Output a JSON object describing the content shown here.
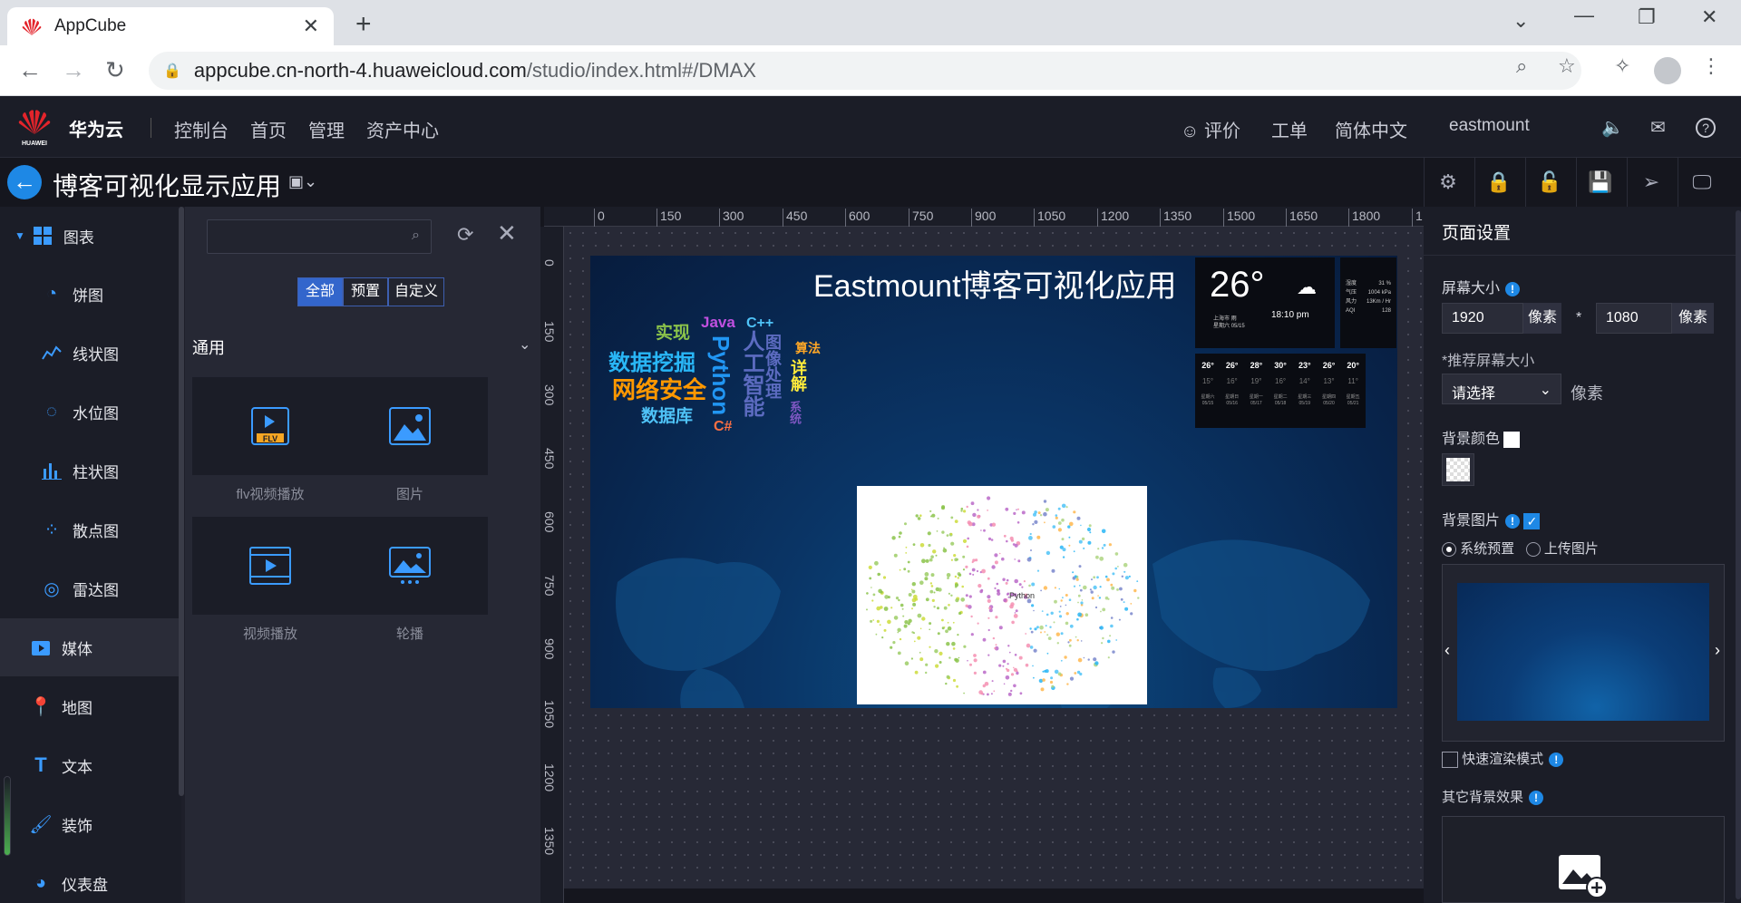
{
  "browser": {
    "tab_title": "AppCube",
    "tab_close": "✕",
    "new_tab": "+",
    "url_host": "appcube.cn-north-4.huaweicloud.com",
    "url_path": "/studio/index.html#/DMAX"
  },
  "header": {
    "brand": "华为云",
    "logo_text": "HUAWEI",
    "nav": [
      "控制台",
      "首页",
      "管理",
      "资产中心"
    ],
    "right": [
      "评价",
      "工单",
      "简体中文",
      "eastmount"
    ]
  },
  "toolbar": {
    "app_title": "博客可视化显示应用"
  },
  "sidebar": {
    "items": [
      {
        "label": "图表",
        "icon": "grid-icon"
      },
      {
        "label": "饼图",
        "icon": "pie-chart-icon"
      },
      {
        "label": "线状图",
        "icon": "line-chart-icon"
      },
      {
        "label": "水位图",
        "icon": "water-level-icon"
      },
      {
        "label": "柱状图",
        "icon": "bar-chart-icon"
      },
      {
        "label": "散点图",
        "icon": "scatter-chart-icon"
      },
      {
        "label": "雷达图",
        "icon": "radar-chart-icon"
      },
      {
        "label": "媒体",
        "icon": "media-icon"
      },
      {
        "label": "地图",
        "icon": "map-pin-icon"
      },
      {
        "label": "文本",
        "icon": "text-icon"
      },
      {
        "label": "装饰",
        "icon": "decoration-icon"
      },
      {
        "label": "仪表盘",
        "icon": "dashboard-icon"
      }
    ]
  },
  "components": {
    "search_placeholder": "",
    "segments": [
      "全部",
      "预置",
      "自定义"
    ],
    "group_title": "通用",
    "cards": [
      {
        "label": "flv视频播放",
        "icon": "flv-icon",
        "badge": "FLV"
      },
      {
        "label": "图片",
        "icon": "image-icon"
      },
      {
        "label": "视频播放",
        "icon": "video-icon"
      },
      {
        "label": "轮播",
        "icon": "carousel-icon"
      }
    ]
  },
  "ruler": {
    "top": [
      "0",
      "150",
      "300",
      "450",
      "600",
      "750",
      "900",
      "1050",
      "1200",
      "1350",
      "1500",
      "1650",
      "1800",
      "1"
    ],
    "left": [
      "0",
      "150",
      "300",
      "450",
      "600",
      "750",
      "900",
      "1050",
      "1200",
      "1350"
    ]
  },
  "screen": {
    "title": "Eastmount博客可视化应用",
    "words": [
      {
        "text": "实现",
        "color": "#8bc34a"
      },
      {
        "text": "Java",
        "color": "#c050e0"
      },
      {
        "text": "C++",
        "color": "#4fc3f7"
      },
      {
        "text": "数据挖掘",
        "color": "#29b6f6"
      },
      {
        "text": "网络安全",
        "color": "#ff9800"
      },
      {
        "text": "数据库",
        "color": "#4fc3f7"
      },
      {
        "text": "Python",
        "color": "#2196f3"
      },
      {
        "text": "C#",
        "color": "#ff7043"
      },
      {
        "text": "人工智能",
        "color": "#5c6bc0"
      },
      {
        "text": "图像处理",
        "color": "#5c6bc0"
      },
      {
        "text": "算法",
        "color": "#ffa726"
      },
      {
        "text": "详解",
        "color": "#ffeb3b"
      },
      {
        "text": "系统",
        "color": "#7e57c2"
      }
    ],
    "weather": {
      "temp": "26°",
      "time": "18:10 pm",
      "city": "上海市",
      "cond": "雨",
      "weekday": "星期六",
      "date": "05/15",
      "side_labels": [
        "湿度",
        "气压",
        "风力",
        "AQI"
      ],
      "side_values": [
        "31 %",
        "1004 kPa",
        "13Km / Hr",
        "128"
      ],
      "days": [
        {
          "hi": "26°",
          "lo": "15°",
          "wd": "星期六",
          "d": "05/15"
        },
        {
          "hi": "26°",
          "lo": "16°",
          "wd": "星期日",
          "d": "05/16"
        },
        {
          "hi": "28°",
          "lo": "19°",
          "wd": "星期一",
          "d": "05/17"
        },
        {
          "hi": "30°",
          "lo": "16°",
          "wd": "星期二",
          "d": "05/18"
        },
        {
          "hi": "23°",
          "lo": "14°",
          "wd": "星期三",
          "d": "05/19"
        },
        {
          "hi": "26°",
          "lo": "13°",
          "wd": "星期四",
          "d": "05/20"
        },
        {
          "hi": "20°",
          "lo": "11°",
          "wd": "星期五",
          "d": "05/21"
        }
      ]
    },
    "graph_center_label": "Python"
  },
  "right_panel": {
    "title": "页面设置",
    "screen_size_label": "屏幕大小",
    "width": "1920",
    "height": "1080",
    "unit": "像素",
    "times": "*",
    "recommended_label": "*推荐屏幕大小",
    "select_placeholder": "请选择",
    "bg_color_label": "背景颜色",
    "bg_image_label": "背景图片",
    "radio_system": "系统预置",
    "radio_upload": "上传图片",
    "fast_render": "快速渲染模式",
    "other_effects": "其它背景效果"
  },
  "colors": {
    "accent": "#1e88e5",
    "header_bg": "#1b1d27",
    "segment_active": "#3366cc"
  }
}
